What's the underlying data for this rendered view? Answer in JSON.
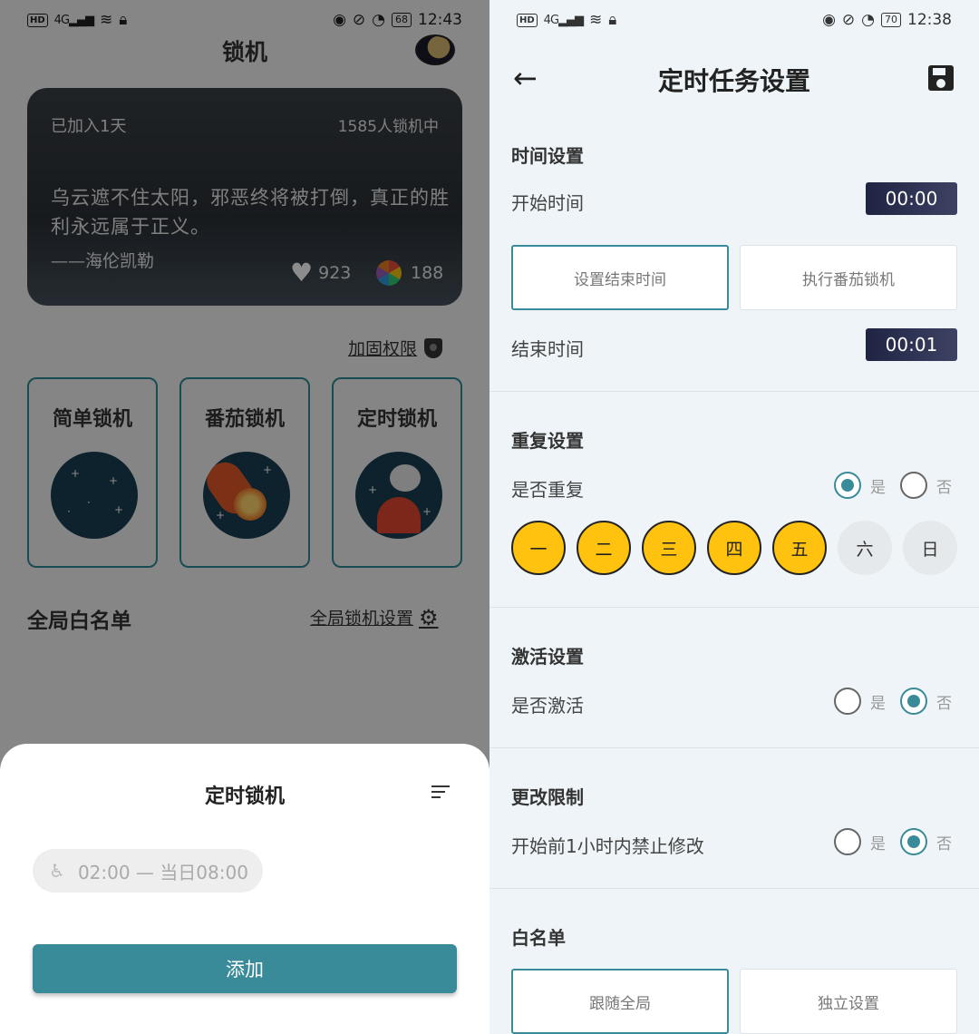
{
  "left": {
    "status": {
      "network": "4G",
      "time": "12:43",
      "battery": "68",
      "hd": "HD"
    },
    "title": "锁机",
    "quote_card": {
      "joined": "已加入1天",
      "locking_count": "1585人锁机中",
      "quote": "乌云遮不住太阳，邪恶终将被打倒，真正的胜利永远属于正义。",
      "author": "——海伦凯勒",
      "likes": "923",
      "shares": "188"
    },
    "permission_link": "加固权限",
    "modes": [
      {
        "label": "简单锁机",
        "icon": "starry-night-icon"
      },
      {
        "label": "番茄锁机",
        "icon": "comet-icon"
      },
      {
        "label": "定时锁机",
        "icon": "satellite-dish-icon"
      }
    ],
    "whitelist_title": "全局白名单",
    "global_settings_link": "全局锁机设置",
    "sheet": {
      "title": "定时锁机",
      "task": "02:00 — 当日08:00",
      "add_button": "添加"
    }
  },
  "right": {
    "status": {
      "network": "4G",
      "time": "12:38",
      "battery": "70",
      "hd": "HD"
    },
    "title": "定时任务设置",
    "time_section": {
      "title": "时间设置",
      "start_label": "开始时间",
      "start_value": "00:00",
      "set_end_button": "设置结束时间",
      "pomodoro_button": "执行番茄锁机",
      "end_label": "结束时间",
      "end_value": "00:01"
    },
    "repeat_section": {
      "title": "重复设置",
      "question": "是否重复",
      "yes": "是",
      "no": "否",
      "selected": "是",
      "days": [
        {
          "label": "一",
          "on": true
        },
        {
          "label": "二",
          "on": true
        },
        {
          "label": "三",
          "on": true
        },
        {
          "label": "四",
          "on": true
        },
        {
          "label": "五",
          "on": true
        },
        {
          "label": "六",
          "on": false
        },
        {
          "label": "日",
          "on": false
        }
      ]
    },
    "activate_section": {
      "title": "激活设置",
      "question": "是否激活",
      "yes": "是",
      "no": "否",
      "selected": "否"
    },
    "limit_section": {
      "title": "更改限制",
      "question": "开始前1小时内禁止修改",
      "yes": "是",
      "no": "否",
      "selected": "否"
    },
    "whitelist_section": {
      "title": "白名单",
      "follow_global": "跟随全局",
      "independent": "独立设置"
    },
    "accent": "#3a8b99",
    "day_on_color": "#ffc20e"
  }
}
